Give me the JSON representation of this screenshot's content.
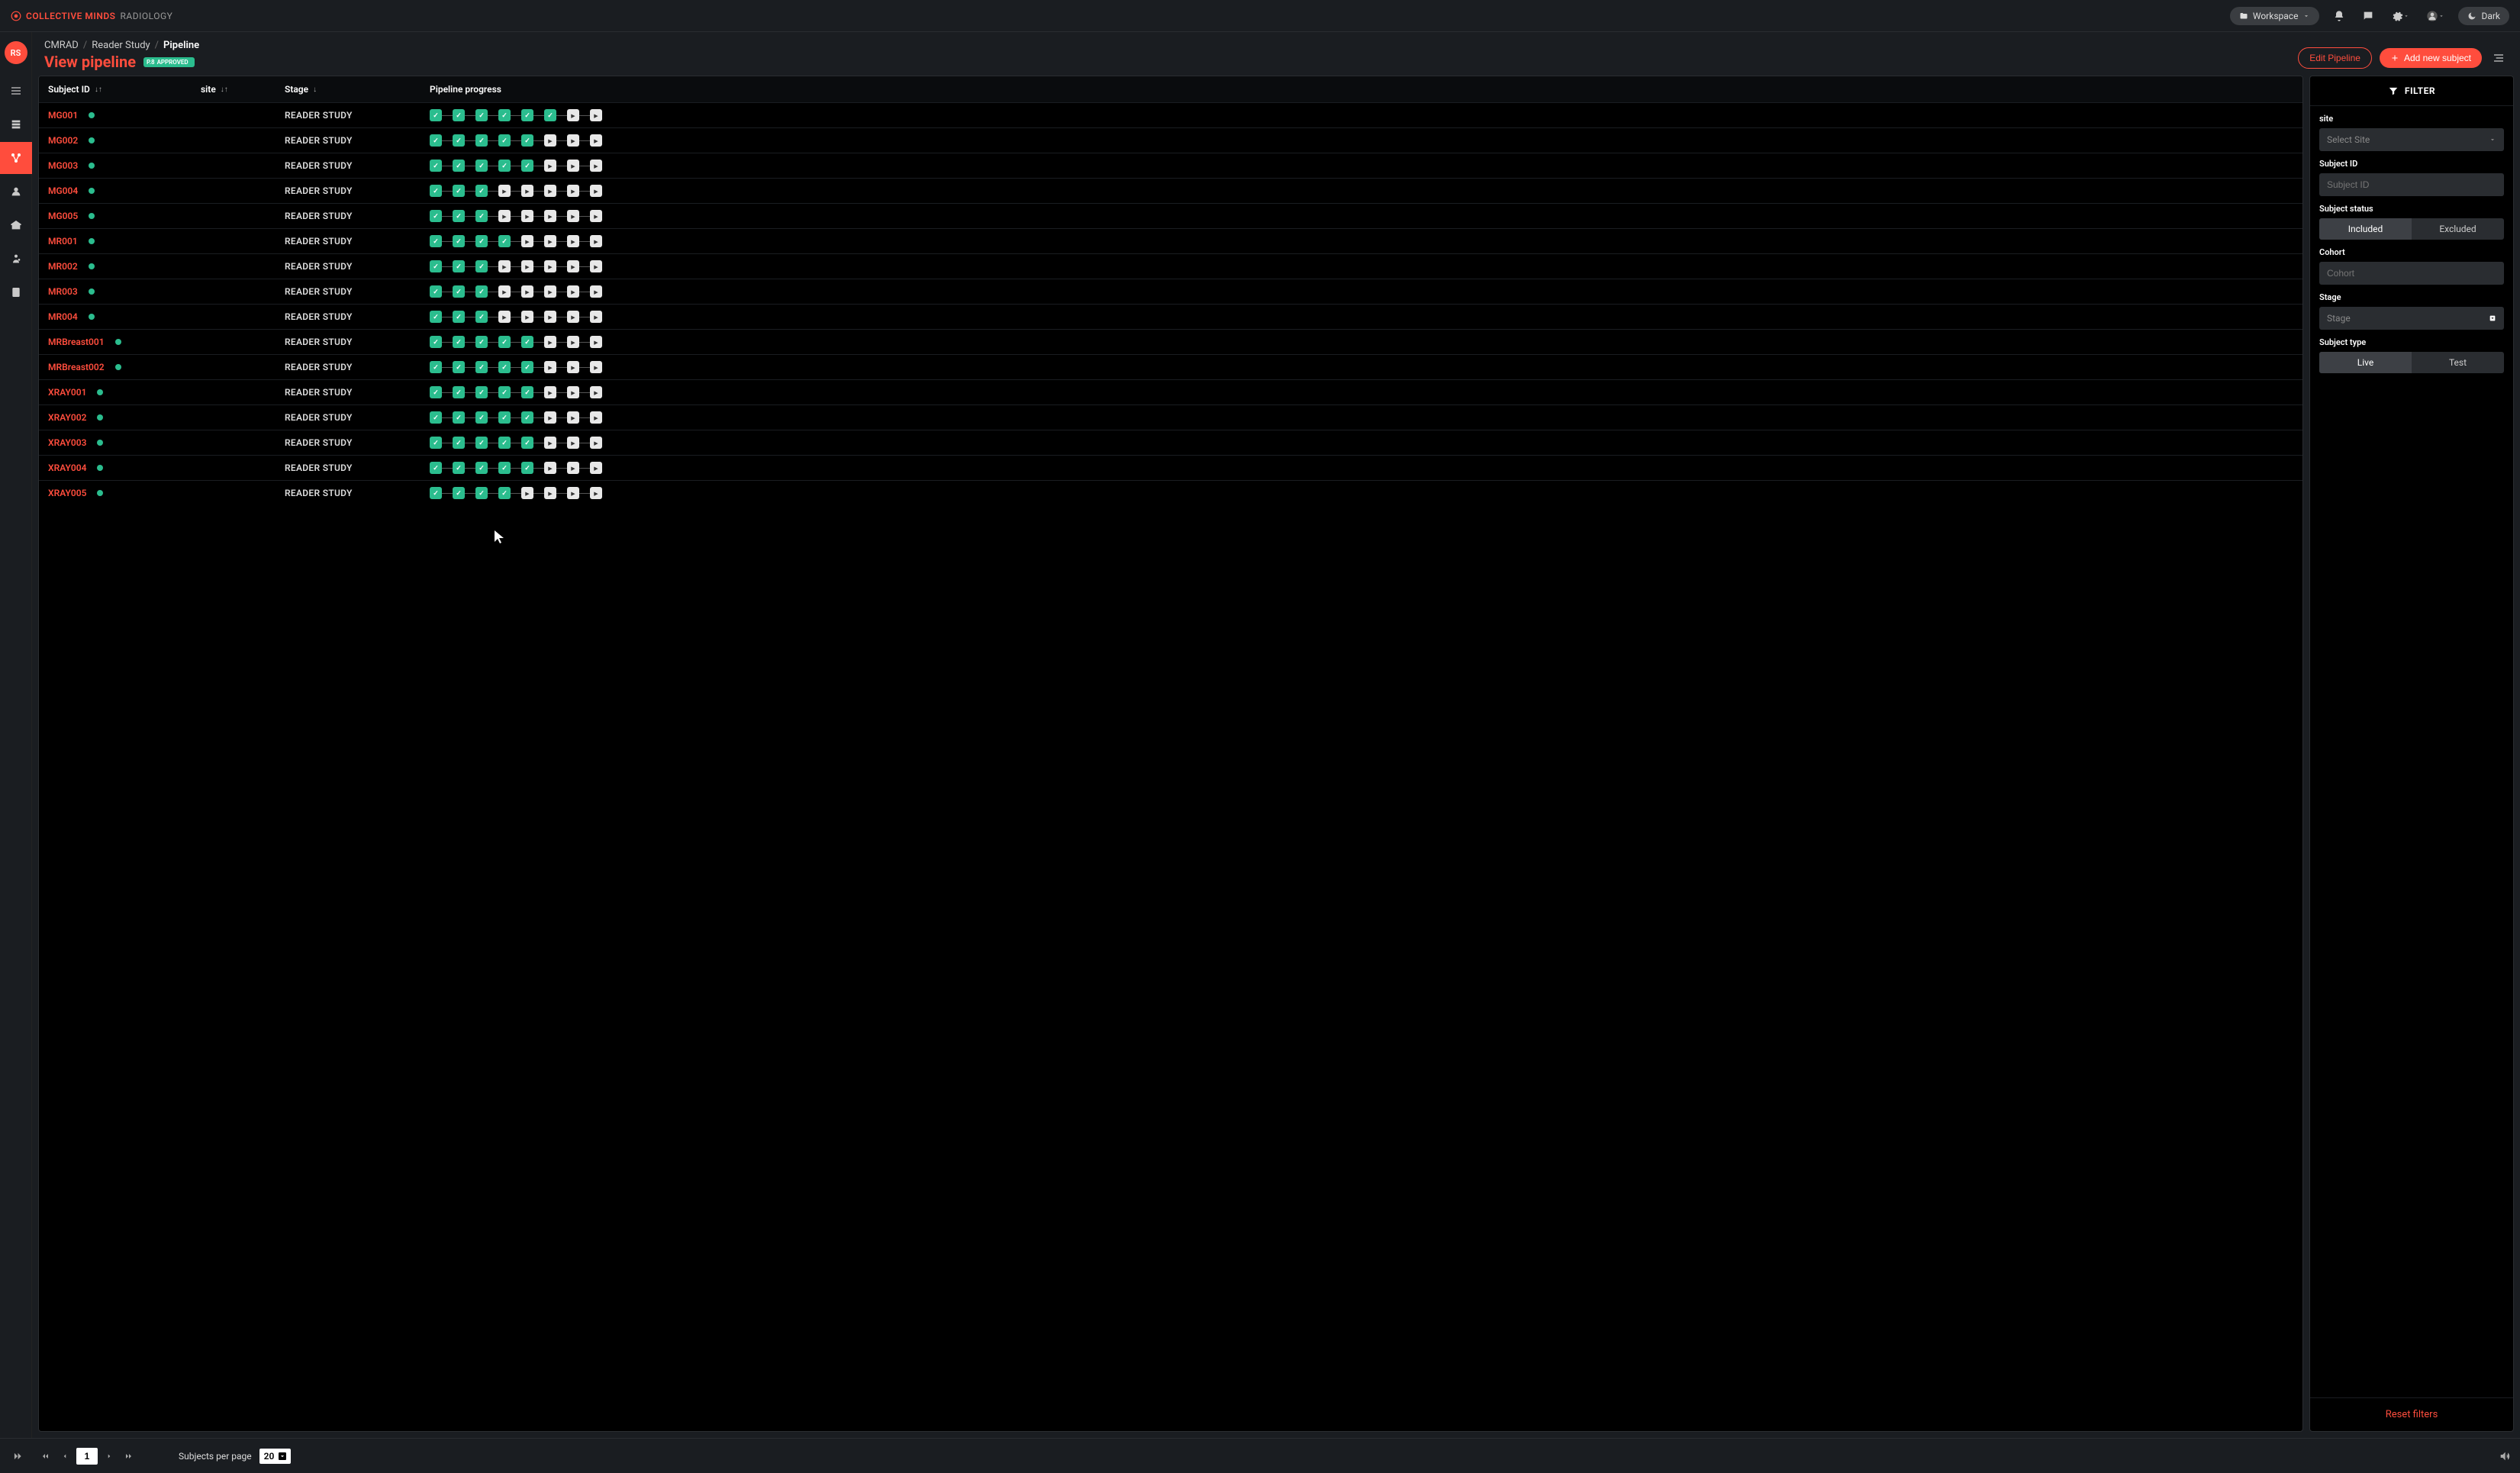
{
  "brand": {
    "primary": "COLLECTIVE MINDS",
    "secondary": "RADIOLOGY"
  },
  "topbar": {
    "workspace_label": "Workspace",
    "dark_label": "Dark"
  },
  "avatar_initials": "RS",
  "breadcrumb": {
    "root": "CMRAD",
    "level1": "Reader Study",
    "current": "Pipeline"
  },
  "page_title": "View pipeline",
  "badge": {
    "prefix": "P.8",
    "text": "APPROVED"
  },
  "actions": {
    "edit_label": "Edit Pipeline",
    "add_label": "Add new subject"
  },
  "columns": {
    "subject_id": "Subject ID",
    "site": "site",
    "stage": "Stage",
    "progress": "Pipeline progress"
  },
  "stage_text": "READER STUDY",
  "rows": [
    {
      "id": "MG001",
      "done": 6
    },
    {
      "id": "MG002",
      "done": 5
    },
    {
      "id": "MG003",
      "done": 5
    },
    {
      "id": "MG004",
      "done": 3
    },
    {
      "id": "MG005",
      "done": 3
    },
    {
      "id": "MR001",
      "done": 4
    },
    {
      "id": "MR002",
      "done": 3
    },
    {
      "id": "MR003",
      "done": 3
    },
    {
      "id": "MR004",
      "done": 3
    },
    {
      "id": "MRBreast001",
      "done": 5
    },
    {
      "id": "MRBreast002",
      "done": 5
    },
    {
      "id": "XRAY001",
      "done": 5
    },
    {
      "id": "XRAY002",
      "done": 5
    },
    {
      "id": "XRAY003",
      "done": 5
    },
    {
      "id": "XRAY004",
      "done": 5
    },
    {
      "id": "XRAY005",
      "done": 4
    }
  ],
  "total_steps": 8,
  "filter": {
    "header": "FILTER",
    "site_label": "site",
    "site_placeholder": "Select Site",
    "subject_id_label": "Subject ID",
    "subject_id_placeholder": "Subject ID",
    "status_label": "Subject status",
    "status_options": {
      "included": "Included",
      "excluded": "Excluded"
    },
    "cohort_label": "Cohort",
    "cohort_placeholder": "Cohort",
    "stage_label": "Stage",
    "stage_placeholder": "Stage",
    "type_label": "Subject type",
    "type_options": {
      "live": "Live",
      "test": "Test"
    },
    "reset": "Reset filters"
  },
  "footer": {
    "page": "1",
    "perpage_label": "Subjects per page",
    "perpage_value": "20"
  }
}
